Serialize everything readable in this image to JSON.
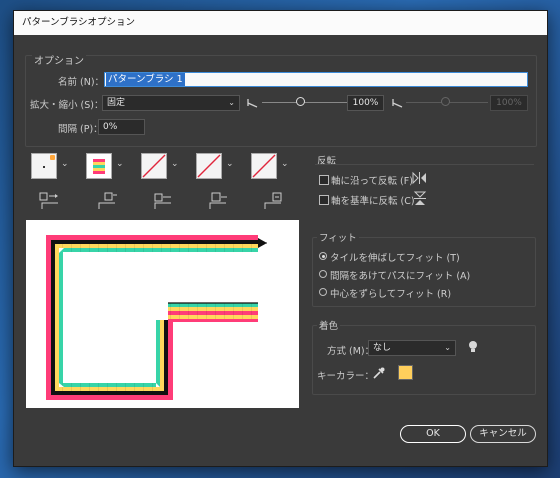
{
  "window": {
    "title": "パターンブラシオプション"
  },
  "options": {
    "heading": "オプション",
    "name_label": "名前 (N)：",
    "name_value": "パターンブラシ 1",
    "scale_label": "拡大・縮小 (S)：",
    "scale_mode": "固定",
    "scale_value": "100%",
    "scale_value_disabled": "100%",
    "spacing_label": "間隔 (P)：",
    "spacing_value": "0%"
  },
  "flip": {
    "heading": "反転",
    "along_label": "軸に沿って反転 (F)",
    "across_label": "軸を基準に反転 (C)"
  },
  "fit": {
    "heading": "フィット",
    "options": [
      "タイルを伸ばしてフィット (T)",
      "間隔をあけてパスにフィット (A)",
      "中心をずらしてフィット (R)"
    ],
    "selected_index": 0
  },
  "colorization": {
    "heading": "着色",
    "method_label": "方式 (M)：",
    "method_value": "なし",
    "key_color_label": "キーカラー：",
    "key_color": "#ffcf5c"
  },
  "buttons": {
    "ok": "OK",
    "cancel": "キャンセル"
  },
  "icons": {
    "tiles": [
      "side-tile-icon",
      "outer-corner-tile-icon",
      "inner-corner-tile-icon",
      "start-tile-icon",
      "end-tile-icon"
    ],
    "tile_kinds": [
      "side",
      "outer-corner",
      "inner-corner",
      "start",
      "end"
    ]
  },
  "colors": {
    "pink": "#ff3c78",
    "yellow": "#ffd75c",
    "teal": "#37d4a8",
    "dark": "#111111",
    "accent": "#2e71c8"
  }
}
